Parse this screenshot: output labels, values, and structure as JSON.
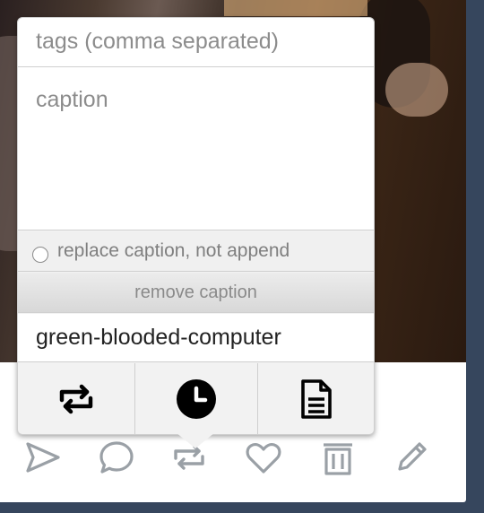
{
  "reblog_form": {
    "tags_placeholder": "tags (comma separated)",
    "caption_placeholder": "caption",
    "replace_caption_label": "replace caption, not append",
    "remove_caption_label": "remove caption",
    "blog_name": "green-blooded-computer"
  },
  "popover_buttons": [
    {
      "icon": "reblog-icon",
      "action": "reblog"
    },
    {
      "icon": "clock-icon",
      "action": "queue"
    },
    {
      "icon": "document-icon",
      "action": "draft"
    }
  ],
  "post_actions": [
    {
      "icon": "send-icon"
    },
    {
      "icon": "comment-icon"
    },
    {
      "icon": "reblog-icon"
    },
    {
      "icon": "heart-icon"
    },
    {
      "icon": "trash-icon"
    },
    {
      "icon": "pencil-icon"
    }
  ],
  "colors": {
    "page_background": "#36465d",
    "icon_gray": "#9aa0a6",
    "icon_dark": "#000000"
  }
}
